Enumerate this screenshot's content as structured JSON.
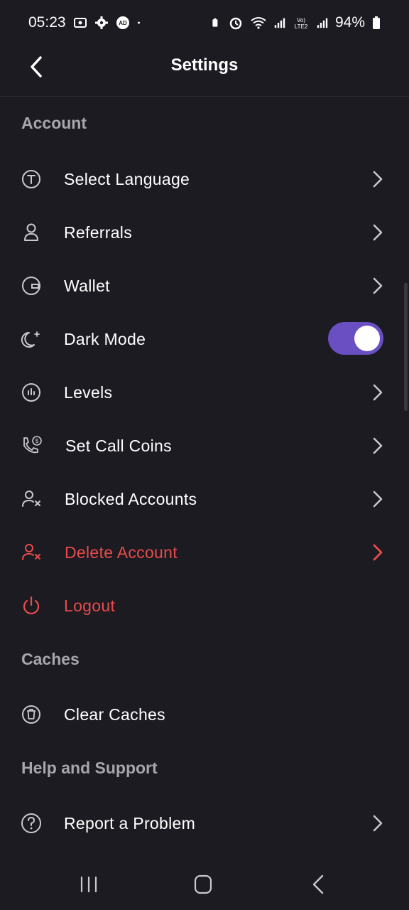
{
  "status_bar": {
    "time": "05:23",
    "battery": "94%",
    "left_icons": [
      "screen-record-icon",
      "gear-icon",
      "ad-icon",
      "dot-icon"
    ],
    "right_icons": [
      "battery-saver-icon",
      "alarm-icon",
      "wifi-icon",
      "signal-icon",
      "volte-icon",
      "signal-icon",
      "battery-icon"
    ]
  },
  "header": {
    "title": "Settings"
  },
  "sections": {
    "account": "Account",
    "caches": "Caches",
    "help": "Help and Support"
  },
  "items": {
    "select_language": "Select Language",
    "referrals": "Referrals",
    "wallet": "Wallet",
    "dark_mode": "Dark Mode",
    "levels": "Levels",
    "set_call_coins": "Set Call Coins",
    "blocked_accounts": "Blocked Accounts",
    "delete_account": "Delete Account",
    "logout": "Logout",
    "clear_caches": "Clear Caches",
    "report_problem": "Report a Problem"
  },
  "toggles": {
    "dark_mode_on": true
  },
  "colors": {
    "background": "#1c1b22",
    "text": "#ffffff",
    "section": "#a7a6ad",
    "danger": "#e84b4b",
    "accent": "#6a4fc3"
  }
}
